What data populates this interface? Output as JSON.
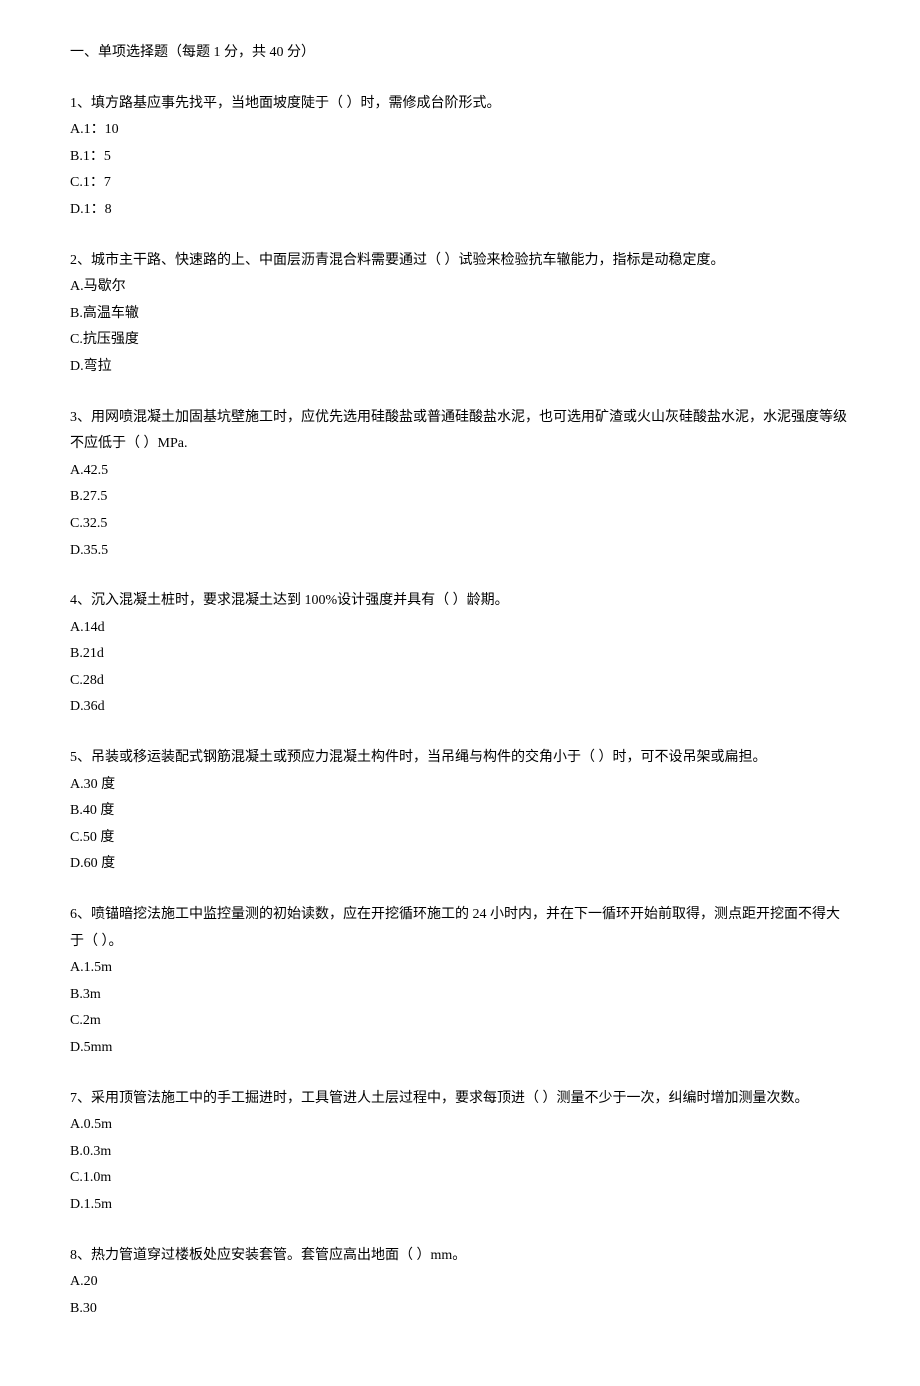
{
  "section_title": "一、单项选择题（每题 1 分，共 40 分）",
  "questions": [
    {
      "stem": "1、填方路基应事先找平，当地面坡度陡于（  ）时，需修成台阶形式。",
      "options": [
        "A.1：10",
        "B.1：5",
        "C.1：7",
        "D.1：8"
      ]
    },
    {
      "stem": "2、城市主干路、快速路的上、中面层沥青混合料需要通过（  ）试验来检验抗车辙能力，指标是动稳定度。",
      "options": [
        "A.马歇尔",
        "B.高温车辙",
        "C.抗压强度",
        "D.弯拉"
      ]
    },
    {
      "stem": "3、用网喷混凝土加固基坑壁施工时，应优先选用硅酸盐或普通硅酸盐水泥，也可选用矿渣或火山灰硅酸盐水泥，水泥强度等级不应低于（  ）MPa.",
      "options": [
        "A.42.5",
        "B.27.5",
        "C.32.5",
        "D.35.5"
      ]
    },
    {
      "stem": "4、沉入混凝土桩时，要求混凝土达到 100%设计强度并具有（  ）龄期。",
      "options": [
        "A.14d",
        "B.21d",
        "C.28d",
        "D.36d"
      ]
    },
    {
      "stem": "5、吊装或移运装配式钢筋混凝土或预应力混凝土构件时，当吊绳与构件的交角小于（  ）时，可不设吊架或扁担。",
      "options": [
        "A.30 度",
        "B.40 度",
        "C.50 度",
        "D.60 度"
      ]
    },
    {
      "stem": "6、喷锚暗挖法施工中监控量测的初始读数，应在开挖循环施工的 24 小时内，并在下一循环开始前取得，测点距开挖面不得大于（  ）。",
      "options": [
        "A.1.5m",
        "B.3m",
        "C.2m",
        "D.5mm"
      ]
    },
    {
      "stem": "7、采用顶管法施工中的手工掘进时，工具管进人土层过程中，要求每顶进（  ）测量不少于一次，纠编时增加测量次数。",
      "options": [
        "A.0.5m",
        "B.0.3m",
        "C.1.0m",
        "D.1.5m"
      ]
    },
    {
      "stem": "8、热力管道穿过楼板处应安装套管。套管应高出地面（  ）mm。",
      "options": [
        "A.20",
        "B.30"
      ]
    }
  ]
}
